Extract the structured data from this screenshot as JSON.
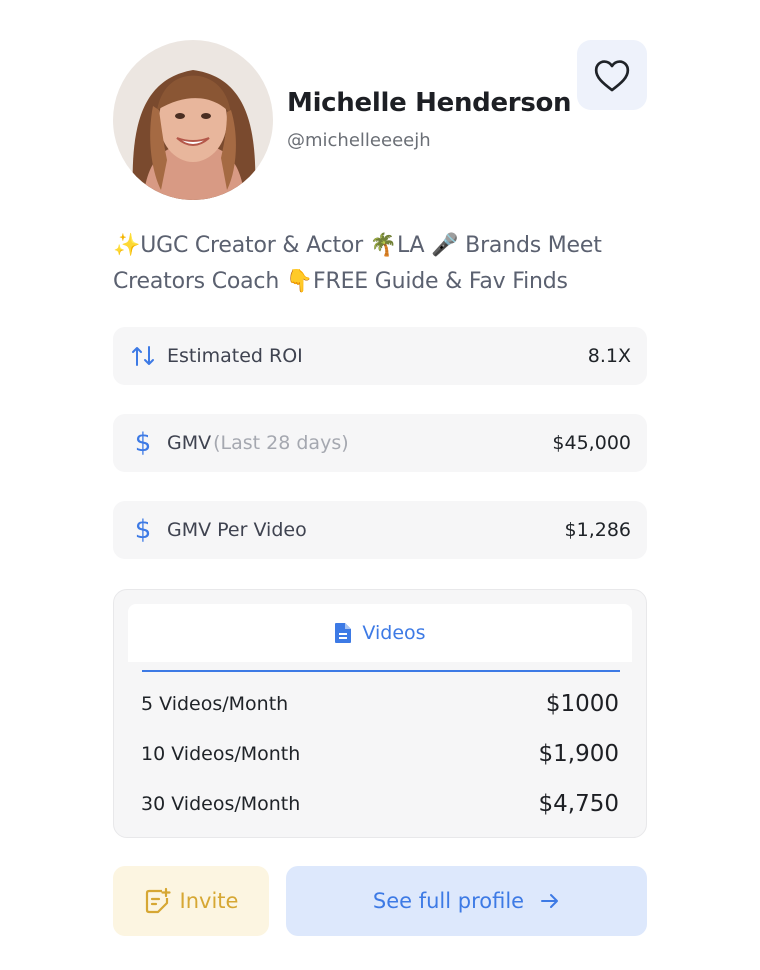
{
  "profile": {
    "name": "Michelle Henderson",
    "handle": "@michelleeeejh",
    "bio": "✨UGC Creator & Actor 🌴LA 🎤 Brands Meet Creators Coach 👇FREE Guide & Fav Finds",
    "avatar_icon": "avatar-photo"
  },
  "favorite": {
    "icon": "heart-icon"
  },
  "stats": [
    {
      "icon": "roi-arrows-icon",
      "label": "Estimated ROI",
      "sub": "",
      "value": "8.1X"
    },
    {
      "icon": "dollar-icon",
      "label": "GMV",
      "sub": "(Last 28 days)",
      "value": "$45,000"
    },
    {
      "icon": "dollar-icon",
      "label": "GMV Per Video",
      "sub": "",
      "value": "$1,286"
    }
  ],
  "videos": {
    "tab_label": "Videos",
    "tab_icon": "document-icon",
    "plans": [
      {
        "label": "5 Videos/Month",
        "price": "$1000"
      },
      {
        "label": "10 Videos/Month",
        "price": "$1,900"
      },
      {
        "label": "30 Videos/Month",
        "price": "$4,750"
      }
    ]
  },
  "actions": {
    "invite_label": "Invite",
    "profile_label": "See full profile"
  },
  "colors": {
    "accent": "#3d7ae5",
    "invite": "#d6a733",
    "card_bg": "#f6f6f7"
  }
}
